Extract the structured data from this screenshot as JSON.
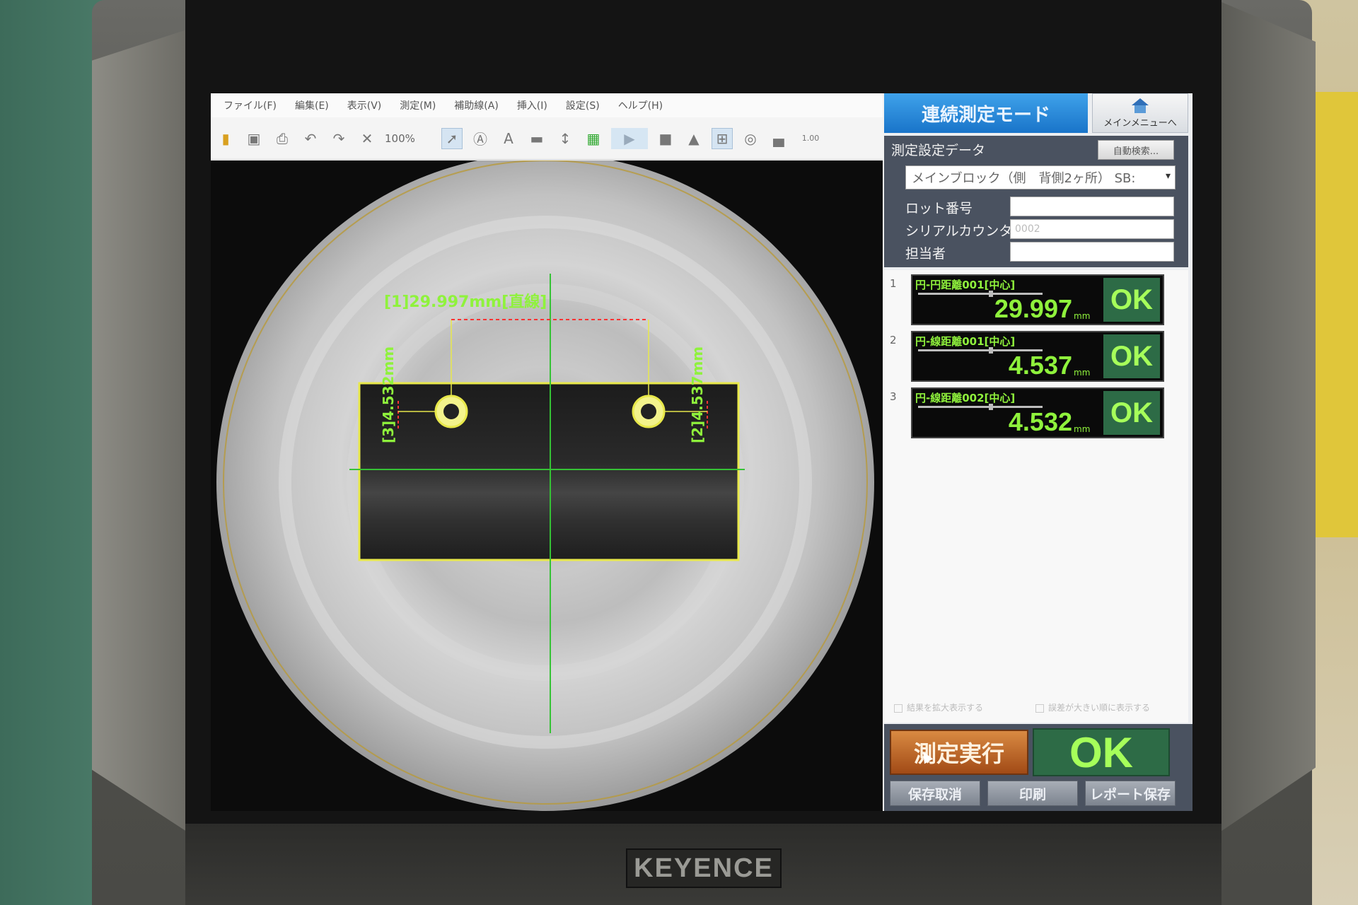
{
  "brand": "KEYENCE",
  "menu": [
    "ファイル(F)",
    "編集(E)",
    "表示(V)",
    "測定(M)",
    "補助線(A)",
    "挿入(I)",
    "設定(S)",
    "ヘルプ(H)"
  ],
  "toolbar": {
    "zoom": "100%",
    "ruler_value": "1.00"
  },
  "viewport": {
    "dim_width_label": "[1]29.997mm[直線]",
    "dim_left_label": "[3]4.532mm",
    "dim_right_label": "[2]4.537mm"
  },
  "panel": {
    "mode_title": "連続測定モード",
    "main_menu_label": "メインメニューへ",
    "settings_label": "測定設定データ",
    "auto_search": "自動検索...",
    "selected_setting": "メインブロック（側　背側2ヶ所）  SB:",
    "fields": [
      {
        "label": "ロット番号",
        "value": ""
      },
      {
        "label": "シリアルカウンタ",
        "value": "0002"
      },
      {
        "label": "担当者",
        "value": ""
      }
    ],
    "results": [
      {
        "num": "1",
        "name": "円-円距離001[中心]",
        "value": "29.997",
        "unit": "mm",
        "status": "OK"
      },
      {
        "num": "2",
        "name": "円-線距離001[中心]",
        "value": "4.537",
        "unit": "mm",
        "status": "OK"
      },
      {
        "num": "3",
        "name": "円-線距離002[中心]",
        "value": "4.532",
        "unit": "mm",
        "status": "OK"
      }
    ],
    "option1": "結果を拡大表示する",
    "option2": "誤差が大きい順に表示する",
    "execute_label": "測定実行",
    "overall_status": "OK",
    "cancel_save": "保存取消",
    "print": "印刷",
    "report_save": "レポート保存"
  },
  "colors": {
    "ok_green": "#2d6b46",
    "ok_text": "#a6ff5a",
    "mode_blue": "#1974c9",
    "execute_orange": "#c16a28",
    "overlay_green": "#8ff23c",
    "overlay_yellow": "#e8e84a",
    "overlay_red": "#ff3333"
  }
}
